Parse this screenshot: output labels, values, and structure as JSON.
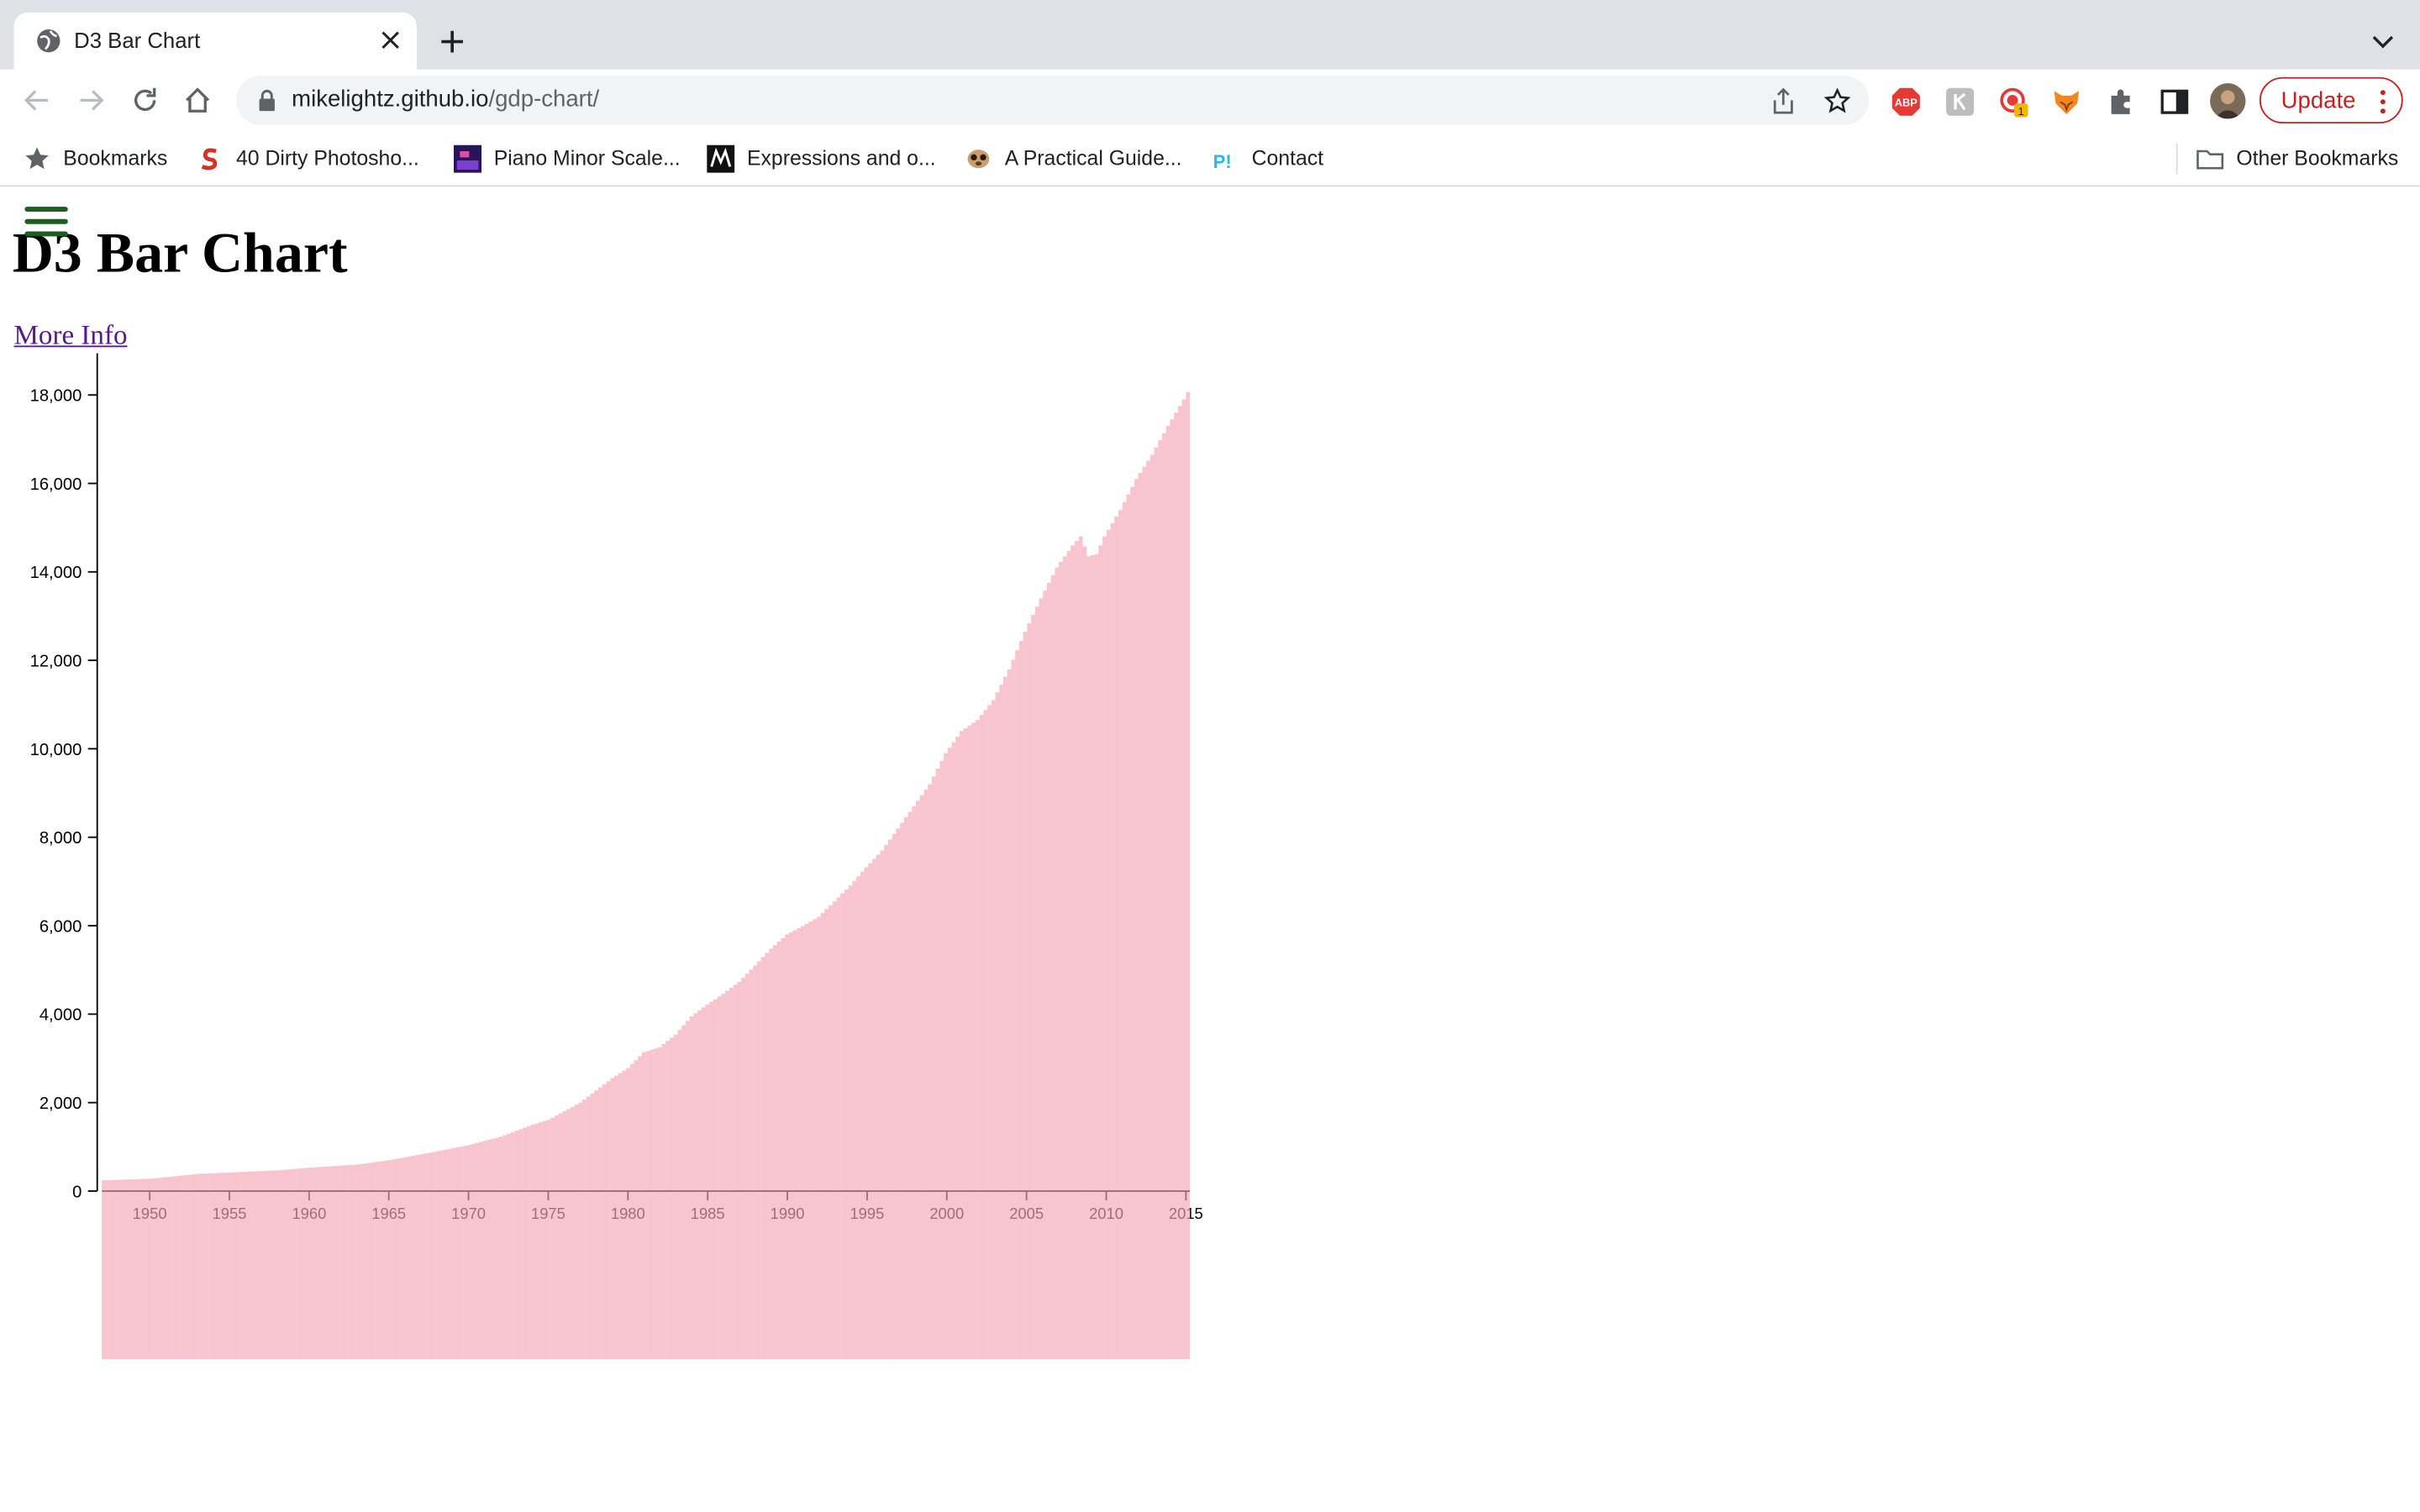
{
  "browser": {
    "tab_title": "D3 Bar Chart",
    "url_host": "mikelightz.github.io",
    "url_path": "/gdp-chart/",
    "update_label": "Update",
    "bookmarks": [
      {
        "label": "Bookmarks",
        "icon": "star-icon"
      },
      {
        "label": "40 Dirty Photosho...",
        "icon": "s-logo-icon"
      },
      {
        "label": "Piano Minor Scale...",
        "icon": "piano-thumbnail-icon"
      },
      {
        "label": "Expressions and o...",
        "icon": "m-logo-icon"
      },
      {
        "label": "A Practical Guide...",
        "icon": "meerkat-icon"
      },
      {
        "label": "Contact",
        "icon": "p-logo-icon"
      }
    ],
    "other_bookmarks": "Other Bookmarks",
    "extension_badge": "1",
    "colors": {
      "tabstrip": "#dee1e6",
      "update": "#c5221f",
      "link_visited": "#551a8b",
      "bar": "#f4a6b4"
    }
  },
  "page": {
    "title": "D3 Bar Chart",
    "more_info": "More Info"
  },
  "chart_data": {
    "type": "bar",
    "x_start_year": 1947,
    "x_end_year": 2015.25,
    "quarters_per_year": 4,
    "ylim": [
      0,
      18000
    ],
    "yticks": [
      0,
      2000,
      4000,
      6000,
      8000,
      10000,
      12000,
      14000,
      16000,
      18000
    ],
    "ytick_labels": [
      "0",
      "2,000",
      "4,000",
      "6,000",
      "8,000",
      "10,000",
      "12,000",
      "14,000",
      "16,000",
      "18,000"
    ],
    "xtick_labels": [
      "1950",
      "1955",
      "1960",
      "1965",
      "1970",
      "1975",
      "1980",
      "1985",
      "1990",
      "1995",
      "2000",
      "2005",
      "2010",
      "2015"
    ],
    "yearly_anchors": [
      [
        1947,
        243
      ],
      [
        1950,
        280
      ],
      [
        1953,
        390
      ],
      [
        1955,
        420
      ],
      [
        1958,
        470
      ],
      [
        1960,
        530
      ],
      [
        1963,
        600
      ],
      [
        1965,
        700
      ],
      [
        1968,
        900
      ],
      [
        1970,
        1040
      ],
      [
        1972,
        1230
      ],
      [
        1974,
        1500
      ],
      [
        1975,
        1610
      ],
      [
        1977,
        2000
      ],
      [
        1979,
        2550
      ],
      [
        1980,
        2780
      ],
      [
        1981,
        3140
      ],
      [
        1982,
        3250
      ],
      [
        1983,
        3540
      ],
      [
        1984,
        3950
      ],
      [
        1985,
        4220
      ],
      [
        1986,
        4460
      ],
      [
        1987,
        4730
      ],
      [
        1988,
        5100
      ],
      [
        1989,
        5480
      ],
      [
        1990,
        5800
      ],
      [
        1991,
        5990
      ],
      [
        1992,
        6200
      ],
      [
        1993,
        6550
      ],
      [
        1994,
        6910
      ],
      [
        1995,
        7320
      ],
      [
        1996,
        7700
      ],
      [
        1997,
        8200
      ],
      [
        1998,
        8700
      ],
      [
        1999,
        9200
      ],
      [
        2000,
        9900
      ],
      [
        2001,
        10400
      ],
      [
        2002,
        10650
      ],
      [
        2003,
        11100
      ],
      [
        2004,
        11800
      ],
      [
        2005,
        12650
      ],
      [
        2006,
        13400
      ],
      [
        2007,
        14100
      ],
      [
        2008,
        14600
      ],
      [
        2008.5,
        14800
      ],
      [
        2009,
        14350
      ],
      [
        2009.5,
        14400
      ],
      [
        2010,
        14800
      ],
      [
        2011,
        15400
      ],
      [
        2012,
        16100
      ],
      [
        2013,
        16650
      ],
      [
        2014,
        17300
      ],
      [
        2015,
        17900
      ],
      [
        2015.25,
        18064
      ]
    ],
    "xlabel": "",
    "ylabel": "",
    "title": ""
  }
}
